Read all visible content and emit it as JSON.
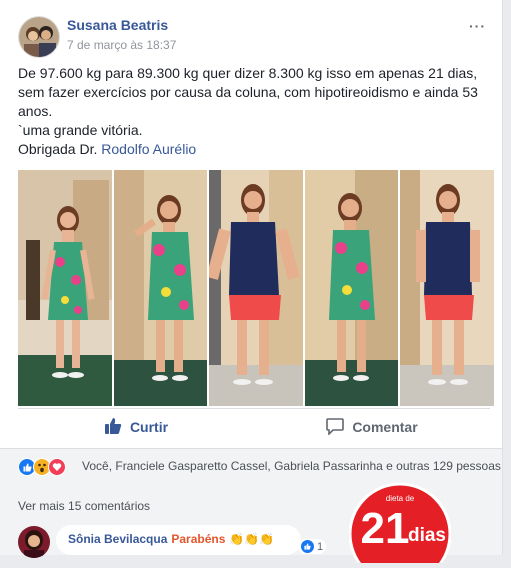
{
  "post": {
    "author": "Susana Beatris",
    "timestamp": "7 de março às 18:37",
    "more_icon": "···",
    "text_line1": "De 97.600 kg para 89.300 kg quer dizer 8.300 kg isso em apenas 21 dias,",
    "text_line2": "sem fazer exercícios por causa da coluna, com hipotireoidismo e ainda 53",
    "text_line3": "anos.",
    "text_line4": "`uma grande vitória.",
    "text_line5_prefix": "Obrigada Dr. ",
    "text_line5_link": "Rodolfo Aurélio"
  },
  "photos": [
    {
      "name": "photo-1",
      "outfit": "floral-dress"
    },
    {
      "name": "photo-2",
      "outfit": "floral-dress"
    },
    {
      "name": "photo-3",
      "outfit": "navy-top-red-shorts"
    },
    {
      "name": "photo-4",
      "outfit": "floral-dress"
    },
    {
      "name": "photo-5",
      "outfit": "navy-top-red-shorts"
    }
  ],
  "actions": {
    "like_label": "Curtir",
    "comment_label": "Comentar",
    "like_icon": "thumbs-up-icon",
    "comment_icon": "speech-bubble-icon"
  },
  "reactions": {
    "icons": [
      "like-icon",
      "wow-icon",
      "love-icon"
    ],
    "summary": "Você, Franciele Gasparetto Cassel, Gabriela Passarinha e outras 129 pessoas"
  },
  "comments": {
    "more_link": "Ver mais 15 comentários",
    "items": [
      {
        "author": "Sônia Bevilacqua",
        "text": "Parabéns",
        "emoji": "👏👏👏",
        "likes": "1"
      }
    ]
  },
  "logo": {
    "top": "dieta de",
    "number": "21",
    "word": "dias"
  },
  "colors": {
    "link": "#385898",
    "like_blue": "#1877f2",
    "love_red": "#f33e58",
    "wow_yellow": "#f7b125",
    "logo_red": "#e41f26"
  }
}
